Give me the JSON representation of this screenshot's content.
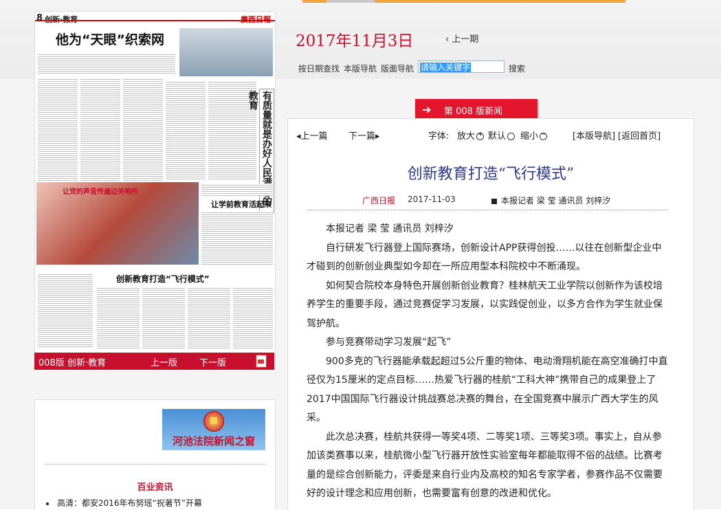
{
  "date": "2017年11月3日",
  "prev_period": "上一期",
  "search_bar": {
    "by_date": "按日期查找",
    "this_edition_nav": "本版导航",
    "layout_nav": "版面导航",
    "input_value": "请输入关键字",
    "search_button": "搜索"
  },
  "page_tab": {
    "arrow": "➔",
    "label": "第 008 版新闻"
  },
  "article_tools": {
    "prev_article": "上一篇",
    "next_article": "下一篇",
    "font_label": "字体:",
    "enlarge": "放大",
    "default": "默认",
    "shrink": "缩小",
    "edition_nav": "[本版导航]",
    "back_home": "[返回首页]"
  },
  "article": {
    "title": "创新教育打造“飞行模式”",
    "paper": "广西日报",
    "date": "2017-11-03",
    "byline": "本报记者 梁 莹 通讯员 刘梓汐",
    "paragraphs": [
      "本报记者 梁 莹  通讯员 刘梓汐",
      "自行研发飞行器登上国际赛场，创新设计APP获得创投……以往在创新型企业中才碰到的创新创业典型如今却在一所应用型本科院校中不断涌现。",
      "如何契合院校本身特色开展创新创业教育？桂林航天工业学院以创新作为该校培养学生的重要手段，通过竞赛促学习发展，以实践促创业，以多方合作为学生就业保驾护航。",
      "参与竞赛带动学习发展“起飞”",
      "900多克的飞行器能承载起超过5公斤重的物体、电动滑翔机能在高空准确打中直径仅为15厘米的定点目标……热爱飞行器的桂航“工科大神”携带自己的成果登上了2017中国国际飞行器设计挑战赛总决赛的舞台，在全国竞赛中展示广西大学生的风采。",
      "此次总决赛，桂航共获得一等奖4项、二等奖1项、三等奖3项。事实上，自从参加该类赛事以来，桂航微小型飞行器开放性实验室每年都能取得不俗的战绩。比赛考量的是综合创新能力，评委是来自行业内及高校的知名专家学者，参赛作品不仅需要好的设计理念和应用创新，也需要富有创意的改进和优化。"
    ]
  },
  "newspaper_thumb": {
    "section_no": "8",
    "section_name": "创新·教育",
    "masthead": "廣西日報",
    "headline_1": "他为“天眼”织索网",
    "headline_2": "创新教育打造“飞行模式”",
    "headline_3": "让学前教育活起来",
    "photo_caption": "让党的声音传遍边关哨所",
    "vertical_box": "有质量就是办好人民满意的教育"
  },
  "paper_nav": {
    "edition": "008版 创新·教育",
    "prev_edition": "上一版",
    "next_edition": "下一版"
  },
  "side_panel": {
    "banner_text": "河池法院新闻之窗",
    "section_title": "百业资讯",
    "items": [
      "高清：都安2016年布努瑶“祝著节”开幕"
    ]
  },
  "colors": {
    "accent_red": "#c8102e",
    "title_blue": "#2d3a8c"
  }
}
